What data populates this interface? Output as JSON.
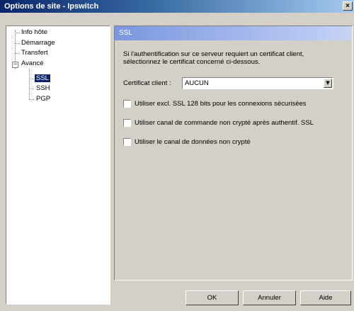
{
  "window": {
    "title": "Options de site - Ipswitch",
    "close_label": "×"
  },
  "tree": {
    "items": [
      {
        "label": "Info hôte"
      },
      {
        "label": "Démarrage"
      },
      {
        "label": "Transfert"
      },
      {
        "label": "Avancé",
        "expander": "−"
      },
      {
        "label": "SSL",
        "selected": true
      },
      {
        "label": "SSH"
      },
      {
        "label": "PGP"
      }
    ]
  },
  "panel": {
    "header": "SSL",
    "info": "Si l'authentification sur ce serveur requiert un certificat client, sélectionnez le certificat concerné ci-dessous.",
    "certificate_label": "Certificat client :",
    "certificate_value": "AUCUN",
    "combo_arrow": "▼",
    "checkboxes": [
      {
        "label": "Utiliser excl. SSL 128 bits pour les connexions sécurisées",
        "checked": false
      },
      {
        "label": "Utiliser canal de commande non crypté après authentif. SSL",
        "checked": false
      },
      {
        "label": "Utiliser le canal de données non crypté",
        "checked": false
      }
    ]
  },
  "buttons": {
    "ok": "OK",
    "cancel": "Annuler",
    "help": "Aide"
  }
}
